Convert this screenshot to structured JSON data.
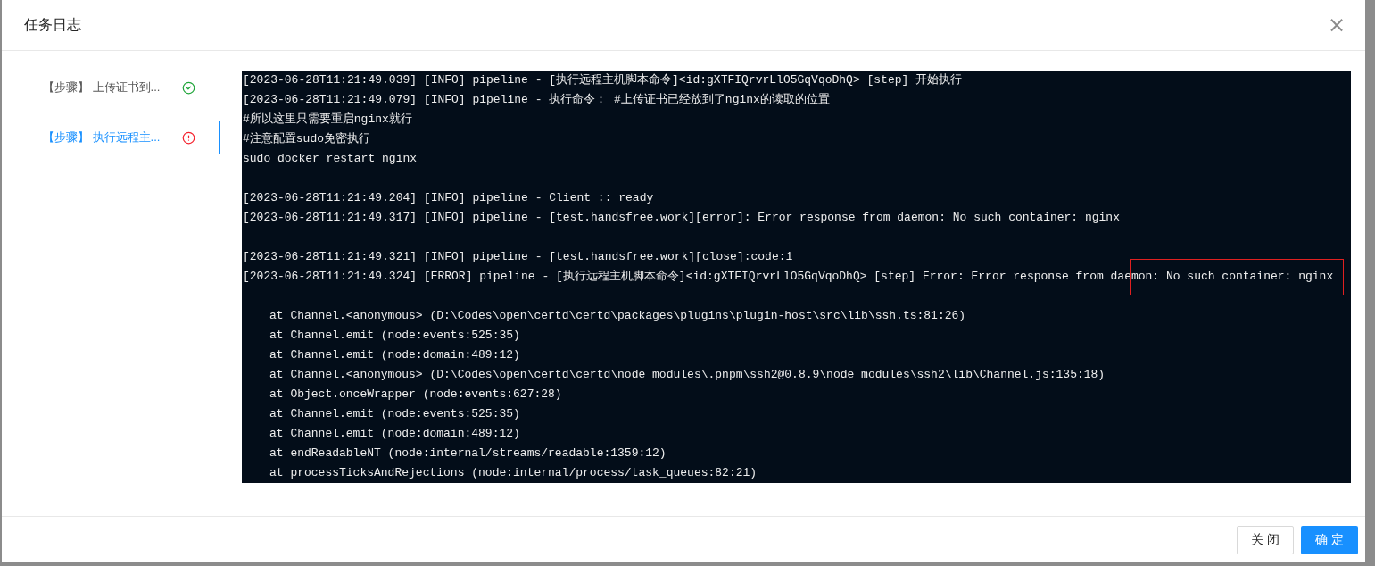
{
  "dialog": {
    "title": "任务日志",
    "close_symbol": "×"
  },
  "steps": [
    {
      "label": "【步骤】 上传证书到...",
      "kind": "success",
      "selected": false
    },
    {
      "label": "【步骤】 执行远程主...",
      "kind": "error",
      "selected": true
    }
  ],
  "log_lines": [
    {
      "kind": "log",
      "text": "[2023-06-28T11:21:49.039] [INFO] pipeline - [执行远程主机脚本命令]<id:gXTFIQrvrLlO5GqVqoDhQ> [step] 开始执行",
      "gap_before": false,
      "highlighted": false
    },
    {
      "kind": "log",
      "text": "[2023-06-28T11:21:49.079] [INFO] pipeline - 执行命令： #上传证书已经放到了nginx的读取的位置",
      "gap_before": false,
      "highlighted": false
    },
    {
      "kind": "log",
      "text": "#所以这里只需要重启nginx就行",
      "gap_before": false,
      "highlighted": false
    },
    {
      "kind": "log",
      "text": "#注意配置sudo免密执行",
      "gap_before": false,
      "highlighted": false
    },
    {
      "kind": "log",
      "text": "sudo docker restart nginx",
      "gap_before": false,
      "highlighted": false
    },
    {
      "kind": "log",
      "text": "[2023-06-28T11:21:49.204] [INFO] pipeline - Client :: ready",
      "gap_before": true,
      "highlighted": false
    },
    {
      "kind": "log",
      "text": "[2023-06-28T11:21:49.317] [INFO] pipeline - [test.handsfree.work][error]: Error response from daemon: No such container: nginx",
      "gap_before": false,
      "highlighted": false
    },
    {
      "kind": "log",
      "text": "[2023-06-28T11:21:49.321] [INFO] pipeline - [test.handsfree.work][close]:code:1",
      "gap_before": true,
      "highlighted": false
    },
    {
      "kind": "log",
      "text": "[2023-06-28T11:21:49.324] [ERROR] pipeline - [执行远程主机脚本命令]<id:gXTFIQrvrLlO5GqVqoDhQ> [step] Error: Error response from daemon: No such container: nginx",
      "gap_before": false,
      "highlighted": true
    },
    {
      "kind": "stack",
      "text": "at Channel.<anonymous> (D:\\Codes\\open\\certd\\certd\\packages\\plugins\\plugin-host\\src\\lib\\ssh.ts:81:26)",
      "gap_before": true,
      "highlighted": false
    },
    {
      "kind": "stack",
      "text": "at Channel.emit (node:events:525:35)",
      "gap_before": false,
      "highlighted": false
    },
    {
      "kind": "stack",
      "text": "at Channel.emit (node:domain:489:12)",
      "gap_before": false,
      "highlighted": false
    },
    {
      "kind": "stack",
      "text": "at Channel.<anonymous> (D:\\Codes\\open\\certd\\certd\\node_modules\\.pnpm\\ssh2@0.8.9\\node_modules\\ssh2\\lib\\Channel.js:135:18)",
      "gap_before": false,
      "highlighted": false
    },
    {
      "kind": "stack",
      "text": "at Object.onceWrapper (node:events:627:28)",
      "gap_before": false,
      "highlighted": false
    },
    {
      "kind": "stack",
      "text": "at Channel.emit (node:events:525:35)",
      "gap_before": false,
      "highlighted": false
    },
    {
      "kind": "stack",
      "text": "at Channel.emit (node:domain:489:12)",
      "gap_before": false,
      "highlighted": false
    },
    {
      "kind": "stack",
      "text": "at endReadableNT (node:internal/streams/readable:1359:12)",
      "gap_before": false,
      "highlighted": false
    },
    {
      "kind": "stack",
      "text": "at processTicksAndRejections (node:internal/process/task_queues:82:21)",
      "gap_before": false,
      "highlighted": false
    }
  ],
  "buttons": [
    {
      "label": "关 闭",
      "kind": "default"
    },
    {
      "label": "确 定",
      "kind": "primary"
    }
  ]
}
